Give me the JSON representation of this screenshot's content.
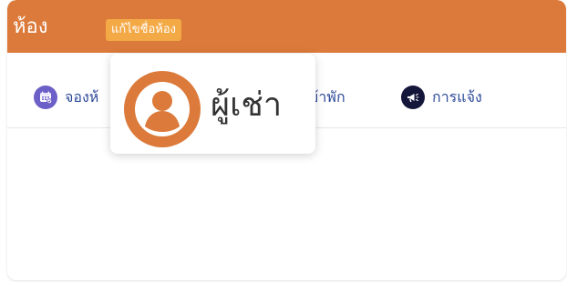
{
  "header": {
    "title": "ห้อง",
    "edit_button_label": "แก้ไขชื่อห้อง"
  },
  "tabs": [
    {
      "label": "จองห้",
      "icon": "calendar-check-icon"
    },
    {
      "label": "เข้าพัก",
      "icon": ""
    },
    {
      "label": "การแจ้ง",
      "icon": "megaphone-icon"
    }
  ],
  "popup": {
    "label": "ผู้เช่า",
    "icon": "user-avatar-icon"
  },
  "colors": {
    "header_bg": "#db7a3a",
    "edit_button_bg": "#f4a947",
    "tab_text": "#2d4a9a",
    "booking_icon_bg": "#6c5fc7",
    "notify_icon_bg": "#14163a",
    "avatar_bg": "#db7a3a"
  }
}
